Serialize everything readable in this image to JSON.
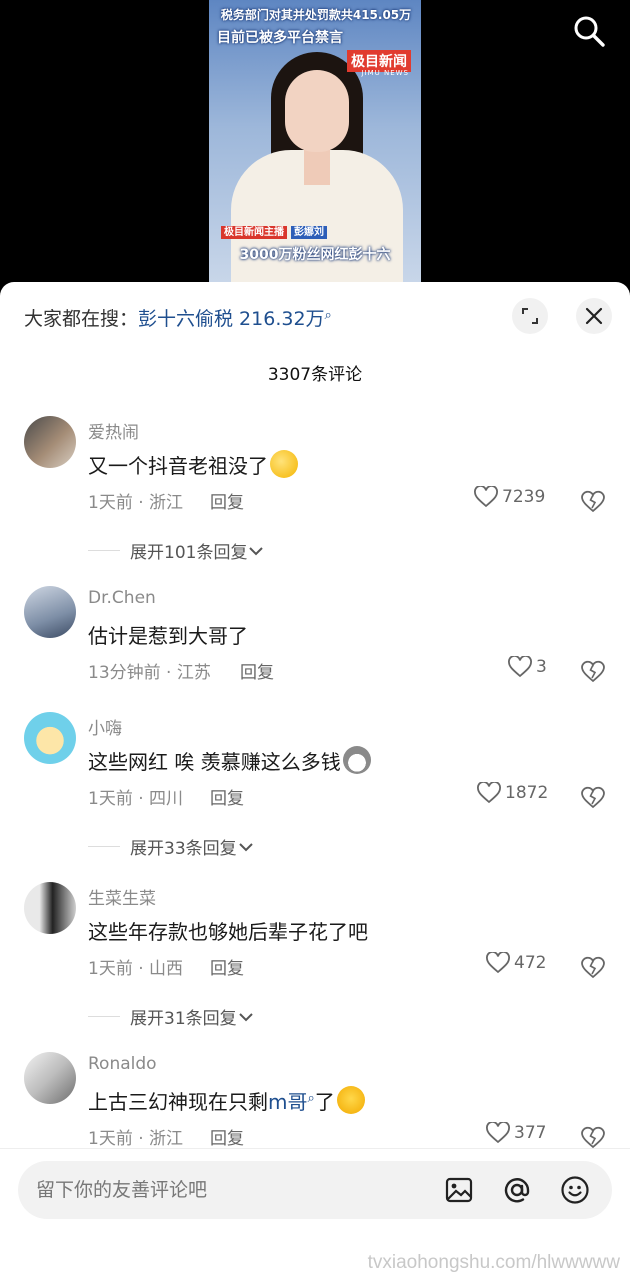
{
  "video": {
    "headline_line1": "税务部门对其并处罚款共415.05万",
    "headline_line2": "目前已被多平台禁言",
    "brand": "极目新闻",
    "brand_sub": "JIMU NEWS",
    "anchor_tag_left": "极目新闻主播",
    "anchor_tag_right": "彭娜刘",
    "caption": "3000万粉丝网红彭十六"
  },
  "sheet": {
    "trending_prefix": "大家都在搜：",
    "trending_topic": "彭十六偷税 216.32万",
    "comment_count": "3307条评论"
  },
  "comments": [
    {
      "username": "爱热闹",
      "text": "又一个抖音老祖没了",
      "time_location": "1天前 · 浙江",
      "reply_label": "回复",
      "likes": "7239",
      "expand_label": "展开101条回复"
    },
    {
      "username": "Dr.Chen",
      "text": "估计是惹到大哥了",
      "time_location": "13分钟前 · 江苏",
      "reply_label": "回复",
      "likes": "3"
    },
    {
      "username": "小嗨",
      "text": "这些网红 唉 羡慕赚这么多钱",
      "time_location": "1天前 · 四川",
      "reply_label": "回复",
      "likes": "1872",
      "expand_label": "展开33条回复"
    },
    {
      "username": "生菜生菜",
      "text": "这些年存款也够她后辈子花了吧",
      "time_location": "1天前 · 山西",
      "reply_label": "回复",
      "likes": "472",
      "expand_label": "展开31条回复"
    },
    {
      "username": "Ronaldo",
      "text_before": "上古三幻神现在只剩",
      "text_link": "m哥",
      "text_after": "了",
      "time_location": "1天前 · 浙江",
      "reply_label": "回复",
      "likes": "377"
    }
  ],
  "input": {
    "placeholder": "留下你的友善评论吧"
  },
  "watermark": "tvxiaohongshu.com/hlwwwww",
  "icons": [
    "search-icon",
    "expand-icon",
    "close-icon",
    "heart-icon",
    "broken-heart-icon",
    "chevron-down-icon",
    "image-icon",
    "at-icon",
    "smiley-icon"
  ],
  "colors": {
    "link": "#1f4f8f",
    "meta": "#8a8a8a",
    "sheet_bg": "#ffffff",
    "video_bg": "#000000"
  }
}
